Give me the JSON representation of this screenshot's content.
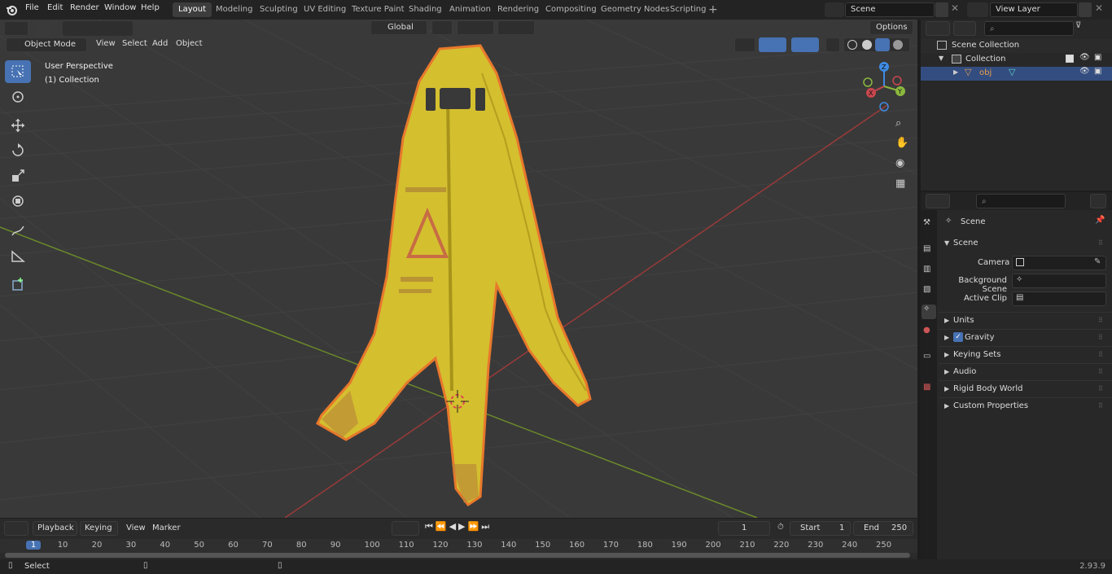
{
  "menu": {
    "file": "File",
    "edit": "Edit",
    "render": "Render",
    "window": "Window",
    "help": "Help"
  },
  "workspaces": [
    "Layout",
    "Modeling",
    "Sculpting",
    "UV Editing",
    "Texture Paint",
    "Shading",
    "Animation",
    "Rendering",
    "Compositing",
    "Geometry Nodes",
    "Scripting"
  ],
  "active_workspace": "Layout",
  "scene_name": "Scene",
  "view_layer": "View Layer",
  "viewport": {
    "mode": "Object Mode",
    "menus": [
      "View",
      "Select",
      "Add",
      "Object"
    ],
    "orientation": "Global",
    "options": "Options",
    "perspective": "User Perspective",
    "collection": "(1) Collection",
    "gizmo": {
      "x": "X",
      "y": "Y",
      "z": "Z"
    }
  },
  "outliner": {
    "scene_collection": "Scene Collection",
    "collection": "Collection",
    "object": "obj"
  },
  "properties": {
    "header": "Scene",
    "panel": "Scene",
    "camera_label": "Camera",
    "bg_scene_label": "Background Scene",
    "active_clip_label": "Active Clip",
    "sections": [
      "Units",
      "Gravity",
      "Keying Sets",
      "Audio",
      "Rigid Body World",
      "Custom Properties"
    ],
    "gravity_checked": true
  },
  "timeline": {
    "menus": [
      "Playback",
      "Keying",
      "View",
      "Marker"
    ],
    "current_frame": "1",
    "start_label": "Start",
    "start": "1",
    "end_label": "End",
    "end": "250",
    "ruler": [
      "1",
      "10",
      "20",
      "30",
      "40",
      "50",
      "60",
      "70",
      "80",
      "90",
      "100",
      "110",
      "120",
      "130",
      "140",
      "150",
      "160",
      "170",
      "180",
      "190",
      "200",
      "210",
      "220",
      "230",
      "240",
      "250"
    ]
  },
  "status": {
    "select": "Select",
    "version": "2.93.9"
  },
  "colors": {
    "accent": "#4772b3",
    "selection_outline": "#e8782c",
    "object_yellow": "#d9c431",
    "x_axis": "#c8474e",
    "y_axis": "#8bb83e",
    "z_axis": "#3f8be5"
  }
}
